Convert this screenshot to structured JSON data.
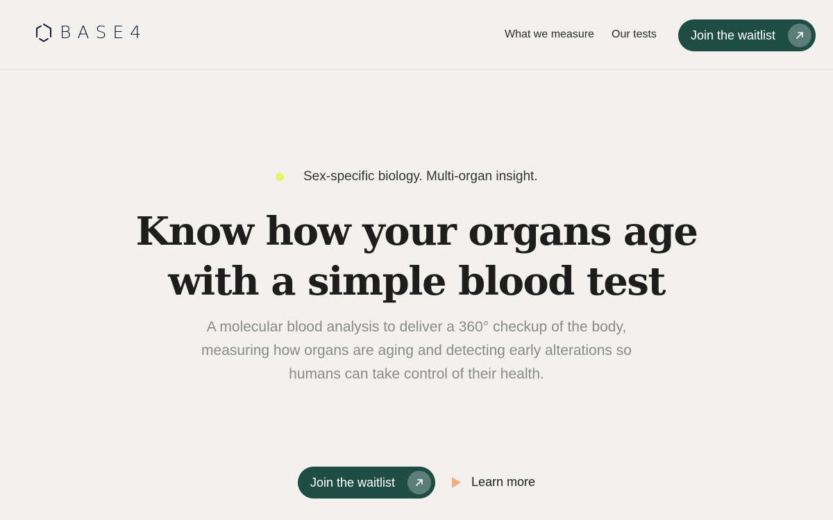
{
  "brand": {
    "name": "BASE4"
  },
  "nav": {
    "items": [
      {
        "label": "What we measure"
      },
      {
        "label": "Our tests"
      }
    ],
    "cta_label": "Join the waitlist"
  },
  "hero": {
    "tagline": "Sex-specific biology. Multi-organ insight.",
    "headline_line1": "Know how your organs age",
    "headline_line2": "with a simple blood test",
    "description": "A molecular blood analysis to deliver a 360° checkup of the body, measuring how organs are aging and detecting early alterations so humans can take control of their health.",
    "primary_cta_label": "Join the waitlist",
    "secondary_cta_label": "Learn more"
  },
  "icons": {
    "logo": "hexagon-logo-icon",
    "button_arrow": "arrow-up-right-icon",
    "tag_dot": "status-dot-icon",
    "learn_more": "play-icon"
  },
  "colors": {
    "background": "#f2f1ee",
    "primary": "#1f4c45",
    "accent_dot": "#e6f56a",
    "play_icon": "#f2b184",
    "muted_text": "#8a8a8a"
  }
}
